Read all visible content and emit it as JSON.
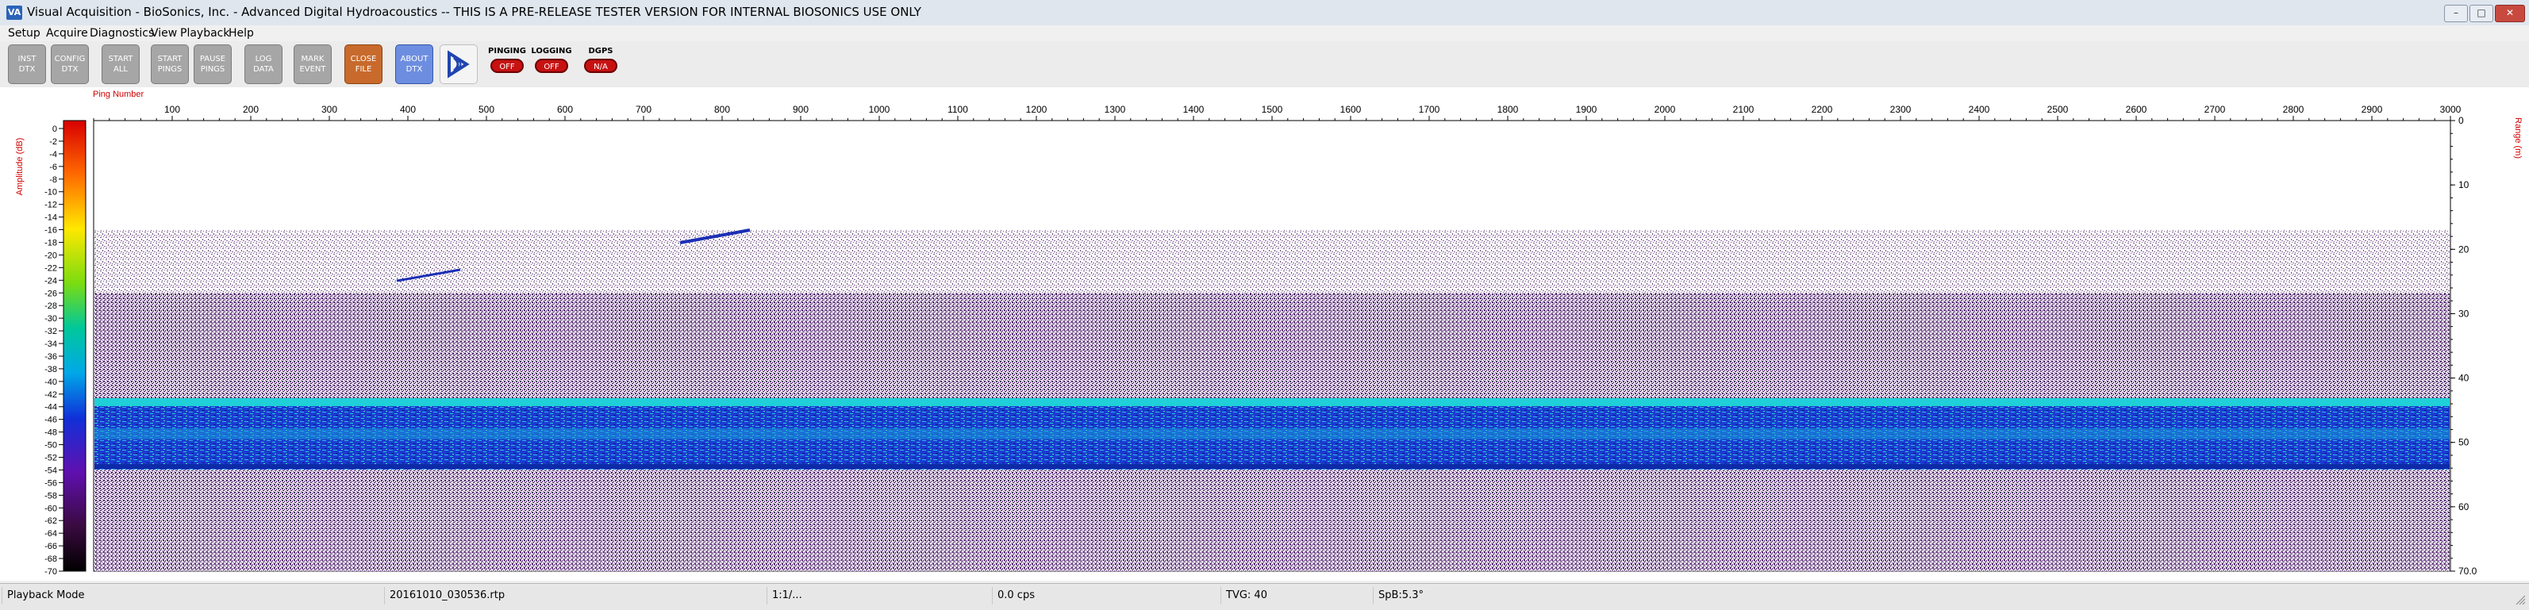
{
  "window": {
    "title": "Visual Acquisition  -  BioSonics, Inc.  -  Advanced Digital Hydroacoustics  --  THIS IS A PRE-RELEASE TESTER VERSION FOR INTERNAL BIOSONICS USE ONLY",
    "icon": "app-icon",
    "icon_text": "VA",
    "controls": {
      "minimize": "–",
      "maximize": "□",
      "close": "✕"
    }
  },
  "menu": [
    "Setup",
    "Acquire",
    "Diagnostics",
    "View",
    "Playback",
    "Help"
  ],
  "toolbar": {
    "buttons": [
      {
        "name": "inst-dtx-button",
        "label": "INST DTX",
        "style": "gray"
      },
      {
        "name": "config-dtx-button",
        "label": "CONFIG DTX",
        "style": "gray"
      },
      {
        "name": "start-all-button",
        "label": "START ALL",
        "style": "gray"
      },
      {
        "name": "start-pings-button",
        "label": "START PINGS",
        "style": "gray"
      },
      {
        "name": "pause-pings-button",
        "label": "PAUSE PINGS",
        "style": "gray"
      },
      {
        "name": "log-data-button",
        "label": "LOG DATA",
        "style": "gray"
      },
      {
        "name": "mark-event-button",
        "label": "MARK EVENT",
        "style": "gray"
      },
      {
        "name": "close-file-button",
        "label": "CLOSE FILE",
        "style": "orange"
      },
      {
        "name": "about-dtx-button",
        "label": "ABOUT DTX",
        "style": "blue"
      }
    ],
    "indicators": [
      {
        "label": "PINGING",
        "value": "OFF"
      },
      {
        "label": "LOGGING",
        "value": "OFF"
      },
      {
        "label": "DGPS",
        "value": "N/A"
      }
    ]
  },
  "echogram": {
    "x_axis_label": "Ping Number",
    "x_ticks": [
      100,
      200,
      300,
      400,
      500,
      600,
      700,
      800,
      900,
      1000,
      1100,
      1200,
      1300,
      1400,
      1500,
      1600,
      1700,
      1800,
      1900,
      2000,
      2100,
      2200,
      2300,
      2400,
      2500,
      2600,
      2700,
      2800,
      2900,
      3000
    ],
    "x_range": [
      0,
      3000
    ],
    "left_axis_label": "Amplitude (dB)",
    "colorbar_ticks": [
      0,
      -2,
      -4,
      -6,
      -8,
      -10,
      -12,
      -14,
      -16,
      -18,
      -20,
      -22,
      -24,
      -26,
      -28,
      -30,
      -32,
      -34,
      -36,
      -38,
      -40,
      -42,
      -44,
      -46,
      -48,
      -50,
      -52,
      -54,
      -56,
      -58,
      -60,
      -62,
      -64,
      -66,
      -68,
      -70
    ],
    "right_axis_label": "Range (m)",
    "range_ticks": [
      "0",
      "10",
      "20",
      "30",
      "40",
      "50",
      "60",
      "70.0"
    ],
    "range_max": 70
  },
  "status": [
    {
      "name": "mode-status",
      "text": "Playback Mode"
    },
    {
      "name": "file-status",
      "text": "20161010_030536.rtp"
    },
    {
      "name": "ratio-status",
      "text": "1:1/..."
    },
    {
      "name": "cps-status",
      "text": "0.0 cps"
    },
    {
      "name": "tvg-status",
      "text": "TVG: 40"
    },
    {
      "name": "spb-status",
      "text": "SpB:5.3°"
    }
  ],
  "colors": {
    "accent_red": "#c81212",
    "axis_red": "#d00000",
    "noise_purple": "#3a0b54",
    "bottom_cyan": "#1fd0d8",
    "bottom_blue": "#1b3bd0"
  }
}
